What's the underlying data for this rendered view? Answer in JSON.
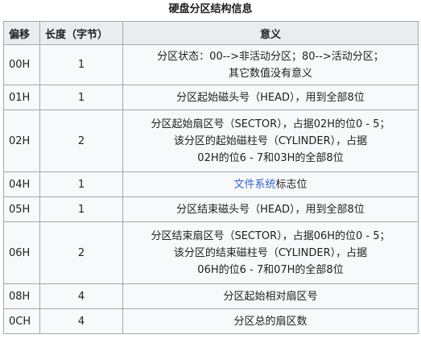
{
  "caption": "硬盘分区结构信息",
  "headers": {
    "offset": "偏移",
    "length": "长度（字节）",
    "meaning": "意义"
  },
  "rows": [
    {
      "offset": "00H",
      "length": "1",
      "meaning_lines": [
        "分区状态：00-->非活动分区；80-->活动分区；",
        "其它数值没有意义"
      ]
    },
    {
      "offset": "01H",
      "length": "1",
      "meaning_lines": [
        "分区起始磁头号（HEAD），用到全部8位"
      ]
    },
    {
      "offset": "02H",
      "length": "2",
      "meaning_lines": [
        "分区起始扇区号（SECTOR），占据02H的位0 - 5；",
        "该分区的起始磁柱号（CYLINDER），占据",
        "02H的位6 - 7和03H的全部8位"
      ]
    },
    {
      "offset": "04H",
      "length": "1",
      "meaning_link": "文件系统",
      "meaning_rest": "标志位"
    },
    {
      "offset": "05H",
      "length": "1",
      "meaning_lines": [
        "分区结束磁头号（HEAD），用到全部8位"
      ]
    },
    {
      "offset": "06H",
      "length": "2",
      "meaning_lines": [
        "分区结束扇区号（SECTOR），占据06H的位0 - 5；",
        "该分区的结束磁柱号（CYLINDER），占据",
        "06H的位6 - 7和07H的全部8位"
      ]
    },
    {
      "offset": "08H",
      "length": "4",
      "meaning_lines": [
        "分区起始相对扇区号"
      ]
    },
    {
      "offset": "0CH",
      "length": "4",
      "meaning_lines": [
        "分区总的扇区数"
      ]
    }
  ],
  "colors": {
    "border": "#a2a9b1",
    "header_bg": "#eaecf0",
    "cell_bg": "#f8f9fa",
    "link": "#3366cc",
    "text": "#202122"
  }
}
